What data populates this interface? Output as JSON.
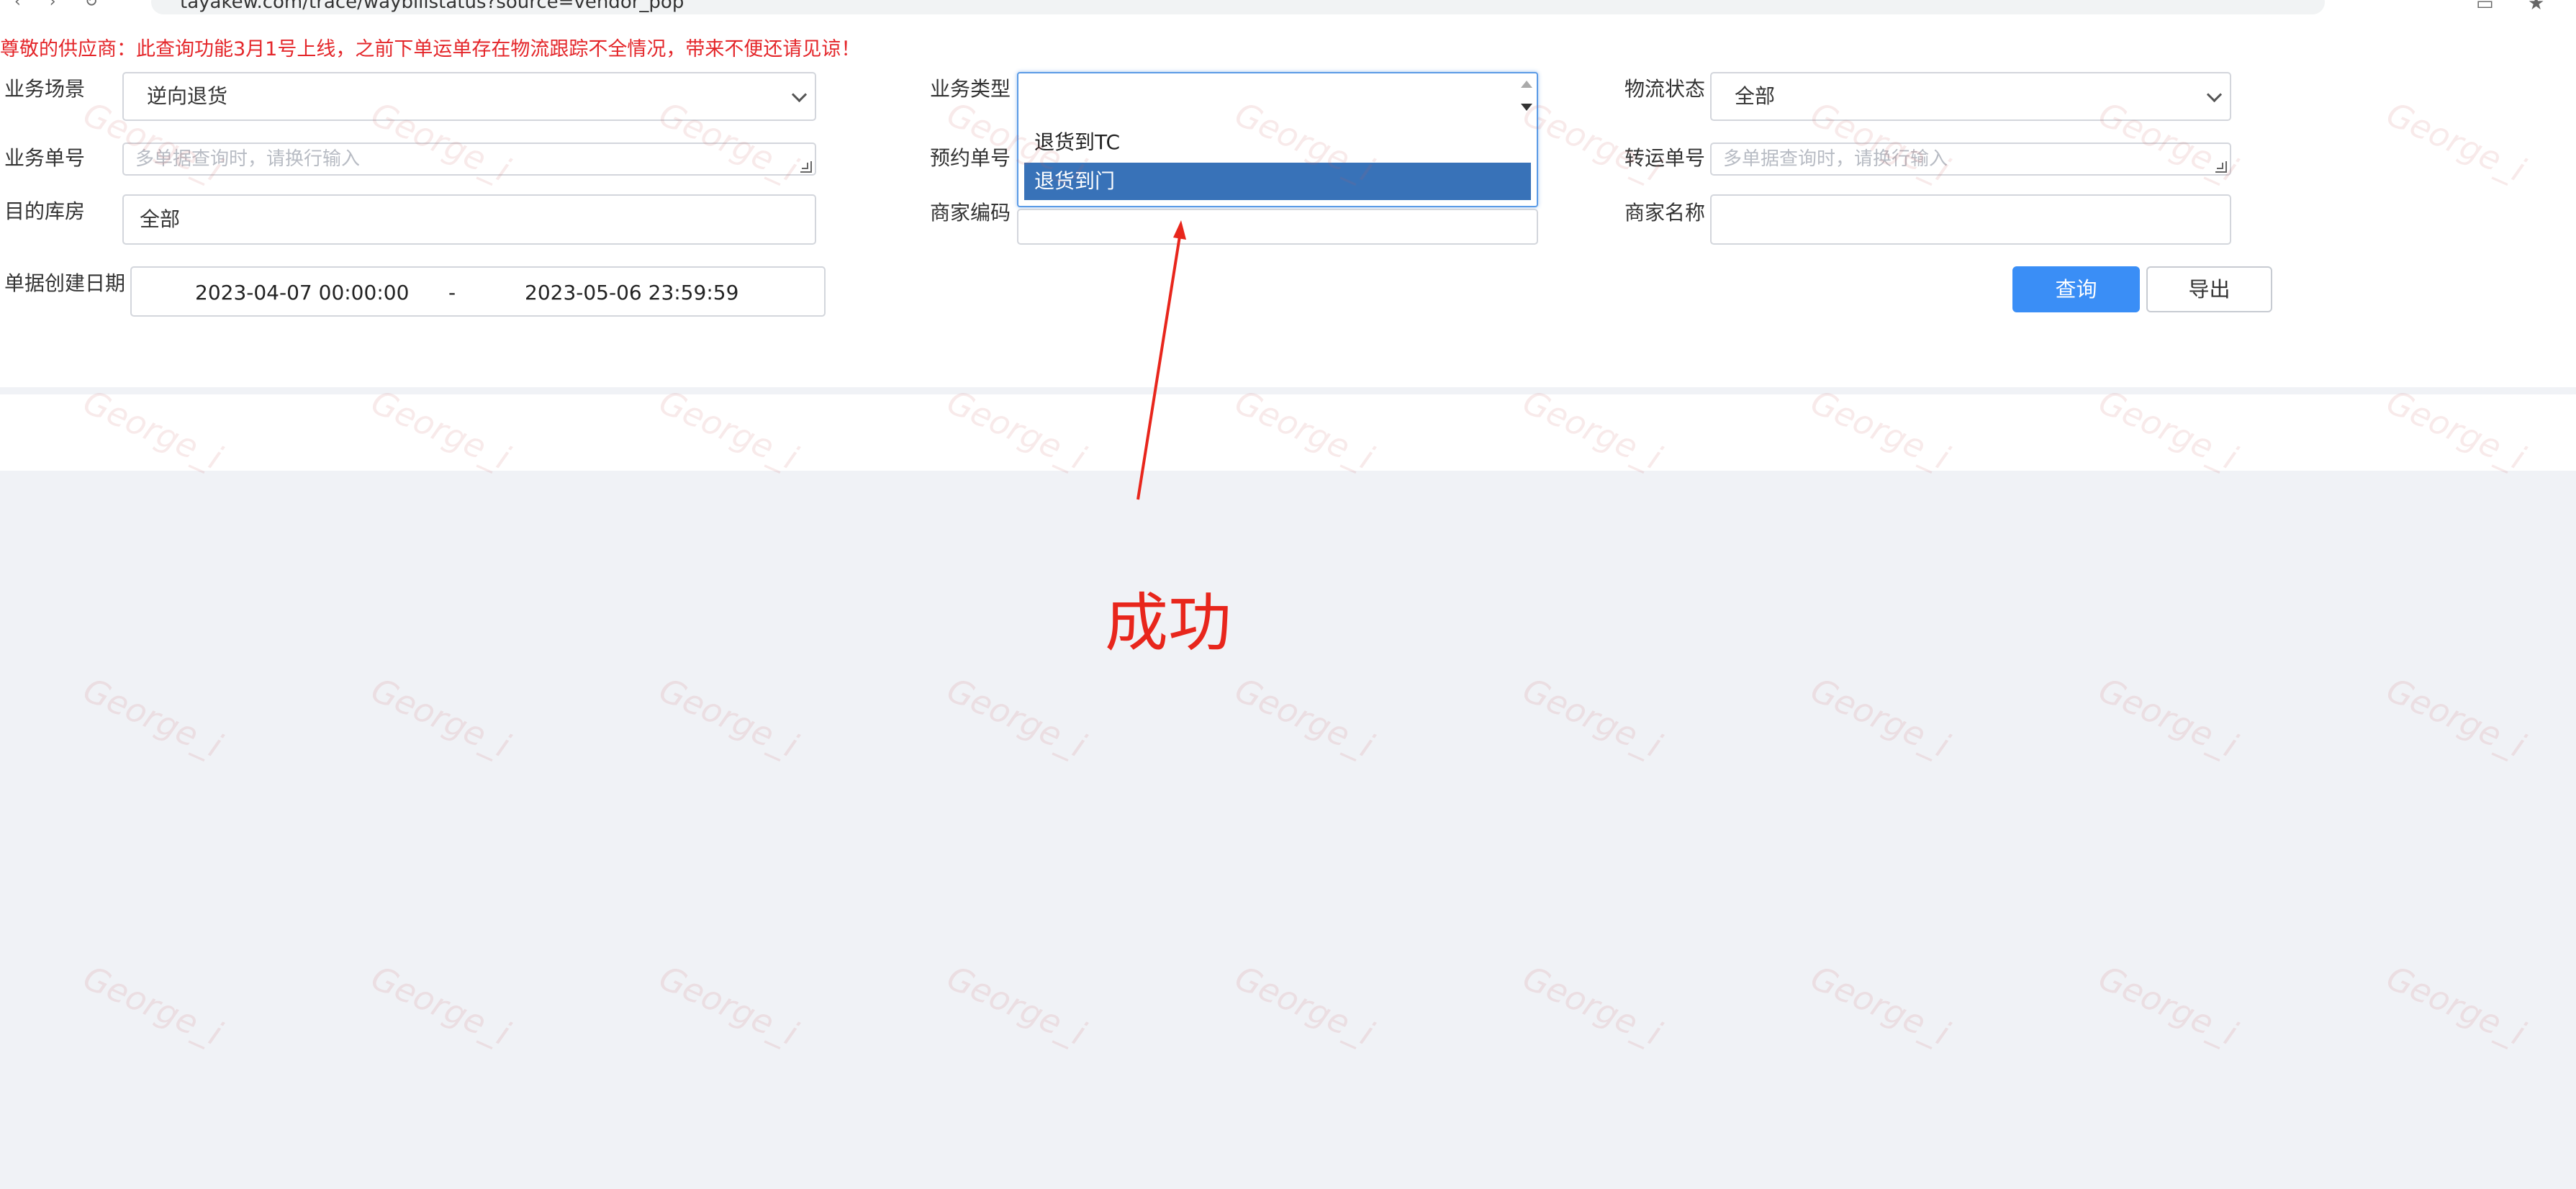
{
  "browser": {
    "url": "tayakew.com/trace/waybillstatus?source=vendor_pop"
  },
  "notice": "尊敬的供应商：此查询功能3月1号上线，之前下单运单存在物流跟踪不全情况，带来不便还请见谅！",
  "form": {
    "biz_scene": {
      "label": "业务场景",
      "value": "逆向退货"
    },
    "biz_type": {
      "label": "业务类型",
      "options": [
        "退货到TC",
        "退货到门"
      ],
      "selected": "退货到门"
    },
    "logistics_status": {
      "label": "物流状态",
      "value": "全部"
    },
    "biz_order": {
      "label": "业务单号",
      "placeholder": "多单据查询时，请换行输入"
    },
    "reserve_order": {
      "label": "预约单号"
    },
    "transfer_order": {
      "label": "转运单号",
      "placeholder": "多单据查询时，请换行输入"
    },
    "target_warehouse": {
      "label": "目的库房",
      "value": "全部"
    },
    "merchant_code": {
      "label": "商家编码"
    },
    "merchant_name": {
      "label": "商家名称"
    },
    "created_date": {
      "label": "单据创建日期",
      "start": "2023-04-07 00:00:00",
      "separator": "-",
      "end": "2023-05-06 23:59:59"
    }
  },
  "buttons": {
    "query": "查询",
    "export": "导出"
  },
  "watermark": "George_i",
  "annotation": {
    "text": "成功"
  },
  "colors": {
    "primary": "#3a8ef6",
    "selected_option": "#3872b8",
    "notice": "#e4262a",
    "annotation": "#e8261c"
  }
}
